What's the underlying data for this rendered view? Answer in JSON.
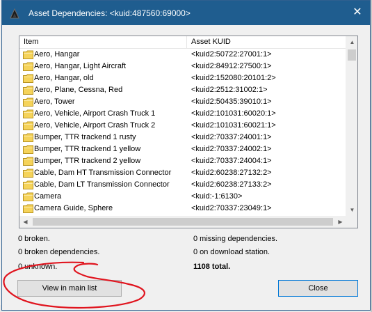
{
  "window": {
    "title": "Asset Dependencies: <kuid:487560:69000>",
    "close_glyph": "✕"
  },
  "list": {
    "headers": {
      "item": "Item",
      "kuid": "Asset KUID"
    },
    "rows": [
      {
        "name": "Aero, Hangar",
        "kuid": "<kuid2:50722:27001:1>"
      },
      {
        "name": "Aero, Hangar, Light Aircraft",
        "kuid": "<kuid2:84912:27500:1>"
      },
      {
        "name": "Aero, Hangar, old",
        "kuid": "<kuid2:152080:20101:2>"
      },
      {
        "name": "Aero, Plane, Cessna, Red",
        "kuid": "<kuid2:2512:31002:1>"
      },
      {
        "name": "Aero, Tower",
        "kuid": "<kuid2:50435:39010:1>"
      },
      {
        "name": "Aero, Vehicle, Airport Crash Truck 1",
        "kuid": "<kuid2:101031:60020:1>"
      },
      {
        "name": "Aero, Vehicle, Airport Crash Truck 2",
        "kuid": "<kuid2:101031:60021:1>"
      },
      {
        "name": "Bumper, TTR trackend 1 rusty",
        "kuid": "<kuid2:70337:24001:1>"
      },
      {
        "name": "Bumper, TTR trackend 1 yellow",
        "kuid": "<kuid2:70337:24002:1>"
      },
      {
        "name": "Bumper, TTR trackend 2 yellow",
        "kuid": "<kuid2:70337:24004:1>"
      },
      {
        "name": "Cable, Dam HT Transmission Connector",
        "kuid": "<kuid2:60238:27132:2>"
      },
      {
        "name": "Cable, Dam LT Transmission Connector",
        "kuid": "<kuid2:60238:27133:2>"
      },
      {
        "name": "Camera",
        "kuid": "<kuid:-1:6130>"
      },
      {
        "name": "Camera Guide, Sphere",
        "kuid": "<kuid2:70337:23049:1>"
      }
    ],
    "row_icon": "folder-icon",
    "row_icon_color": "#f5d35a"
  },
  "stats": {
    "broken": "0 broken.",
    "broken_dependencies": "0 broken dependencies.",
    "unknown": "0 unknown.",
    "missing_dependencies": "0 missing dependencies.",
    "on_download_station": "0 on download station.",
    "total": "1108 total."
  },
  "buttons": {
    "view_in_main_list": "View in main list",
    "close": "Close"
  },
  "colors": {
    "titlebar": "#1f5d8f",
    "annotation": "#e0141e"
  }
}
